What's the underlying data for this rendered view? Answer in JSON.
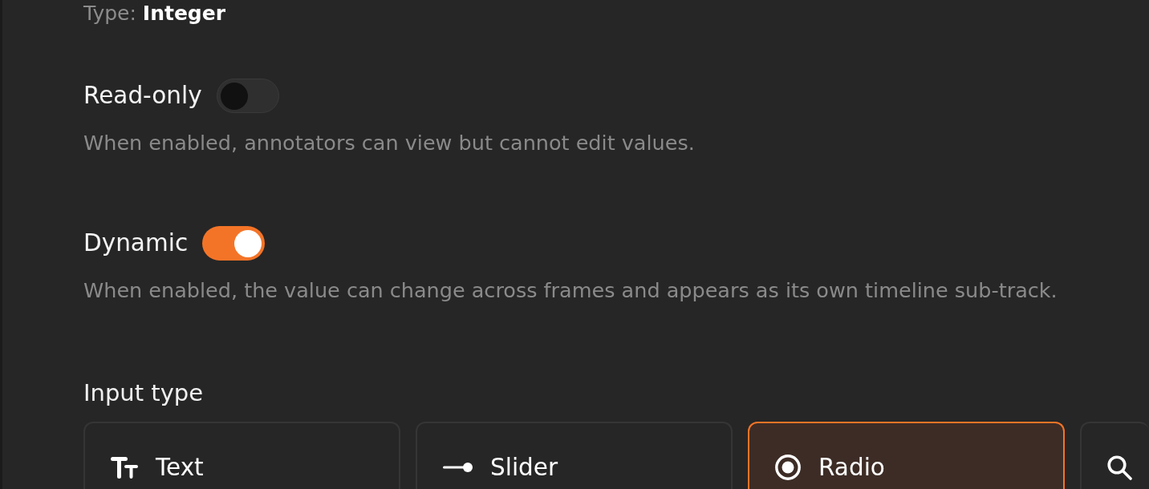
{
  "type_line": {
    "label": "Type:",
    "value": "Integer"
  },
  "settings": [
    {
      "label": "Read-only",
      "on": false,
      "description": "When enabled, annotators can view but cannot edit values."
    },
    {
      "label": "Dynamic",
      "on": true,
      "description": "When enabled, the value can change across frames and appears as its own timeline sub-track."
    }
  ],
  "input_type": {
    "label": "Input type",
    "options": [
      {
        "label": "Text",
        "selected": false
      },
      {
        "label": "Slider",
        "selected": false
      },
      {
        "label": "Radio",
        "selected": true
      },
      {
        "selected": false
      }
    ]
  }
}
